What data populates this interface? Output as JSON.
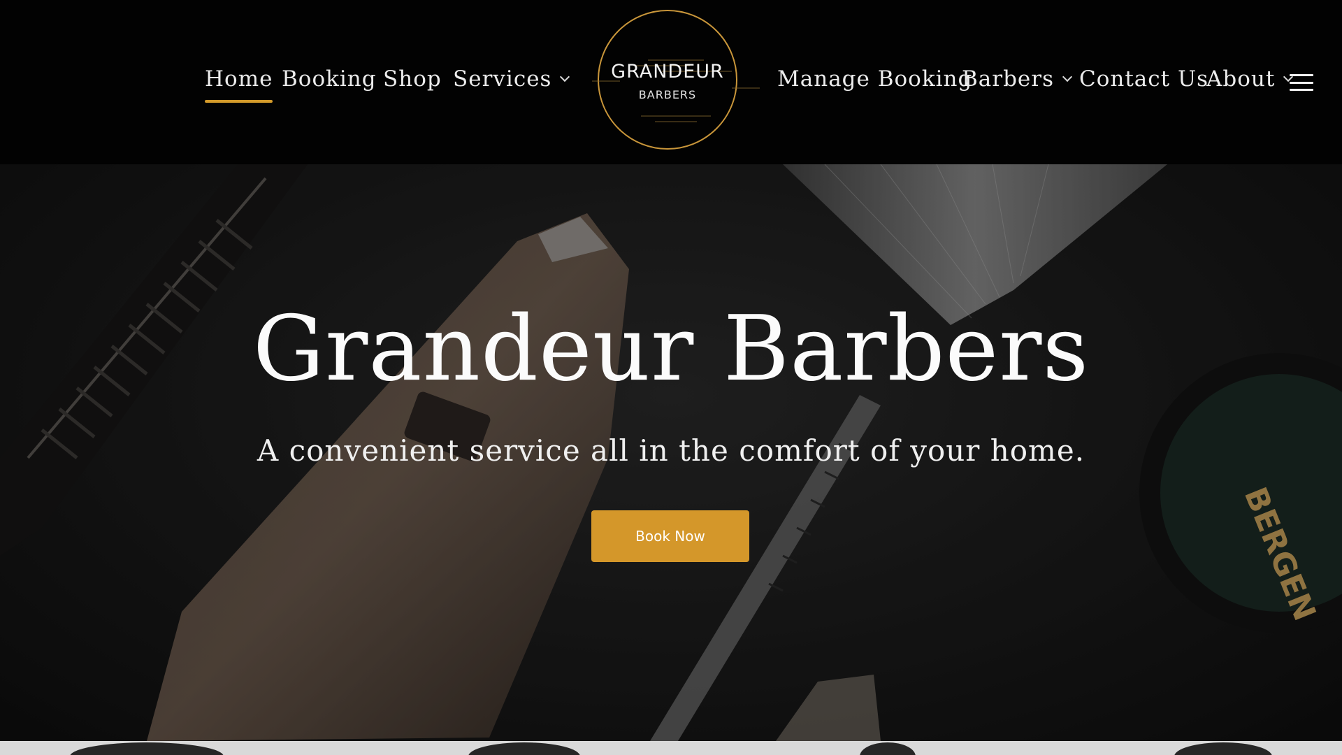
{
  "nav": {
    "left": [
      {
        "label": "Home",
        "active": true,
        "dropdown": false
      },
      {
        "label": "Booking",
        "active": false,
        "dropdown": false
      },
      {
        "label": "Shop",
        "active": false,
        "dropdown": false
      },
      {
        "label": "Services",
        "active": false,
        "dropdown": true
      }
    ],
    "right": [
      {
        "label": "Manage Booking",
        "active": false,
        "dropdown": false
      },
      {
        "label": "Barbers",
        "active": false,
        "dropdown": true
      },
      {
        "label": "Contact Us",
        "active": false,
        "dropdown": false
      },
      {
        "label": "About",
        "active": false,
        "dropdown": true
      }
    ],
    "menu_icon": "hamburger-icon"
  },
  "logo": {
    "main": "GRANDEUR",
    "sub": "BARBERS"
  },
  "hero": {
    "title": "Grandeur Barbers",
    "subtitle": "A convenient service all in the comfort of your home.",
    "cta_label": "Book Now"
  },
  "colors": {
    "accent": "#d4972a",
    "header_bg": "#020202",
    "text": "#f0f0f0"
  }
}
